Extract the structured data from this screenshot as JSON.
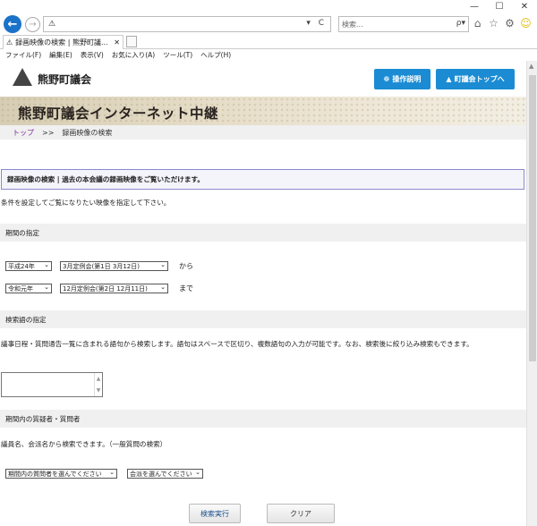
{
  "browser": {
    "window_controls": {
      "minimize": "—",
      "maximize": "☐",
      "close": "✕"
    },
    "address": {
      "value": "",
      "warning_icon": "warning-icon"
    },
    "address_tools": "▾ C",
    "search": {
      "placeholder": "検索...",
      "tools": "ρ▾"
    },
    "toolbar_icons": [
      "home-icon",
      "star-icon",
      "gear-icon",
      "smiley-icon"
    ],
    "tab": {
      "label": "録画映像の検索 | 熊野町議...",
      "close": "✕"
    },
    "menu": [
      "ファイル(F)",
      "編集(E)",
      "表示(V)",
      "お気に入り(A)",
      "ツール(T)",
      "ヘルプ(H)"
    ]
  },
  "header": {
    "logo_text": "熊野町議会",
    "guide_button": "操作説明",
    "top_button": "町議会トップへ"
  },
  "banner": {
    "title": "熊野町議会インターネット中継"
  },
  "breadcrumb": {
    "top": "トップ",
    "separator": ">>",
    "current": "録画映像の検索"
  },
  "intro": {
    "title": "録画映像の検索 | 過去の本会議の録画映像をご覧いただけます。",
    "description": "条件を設定してご覧になりたい映像を指定して下さい。"
  },
  "period": {
    "heading": "期間の指定",
    "from_era": "平成24年",
    "from_meeting": "3月定例会(第1日 3月12日)",
    "from_suffix": "から",
    "to_era": "令和元年",
    "to_meeting": "12月定例会(第2日 12月11日)",
    "to_suffix": "まで"
  },
  "keyword": {
    "heading": "検索語の指定",
    "description": "議事日程・質問通告一覧に含まれる語句から検索します。語句はスペースで区切り、複数語句の入力が可能です。なお、検索後に絞り込み検索もできます。",
    "value": ""
  },
  "questioner": {
    "heading": "期間内の質疑者・質問者",
    "description": "議員名、会派名から検索できます。（一般質問の検索）",
    "member_select": "期間内の質問者を選んでください",
    "faction_select": "会派を選んでください"
  },
  "actions": {
    "search": "検索実行",
    "clear": "クリア"
  }
}
